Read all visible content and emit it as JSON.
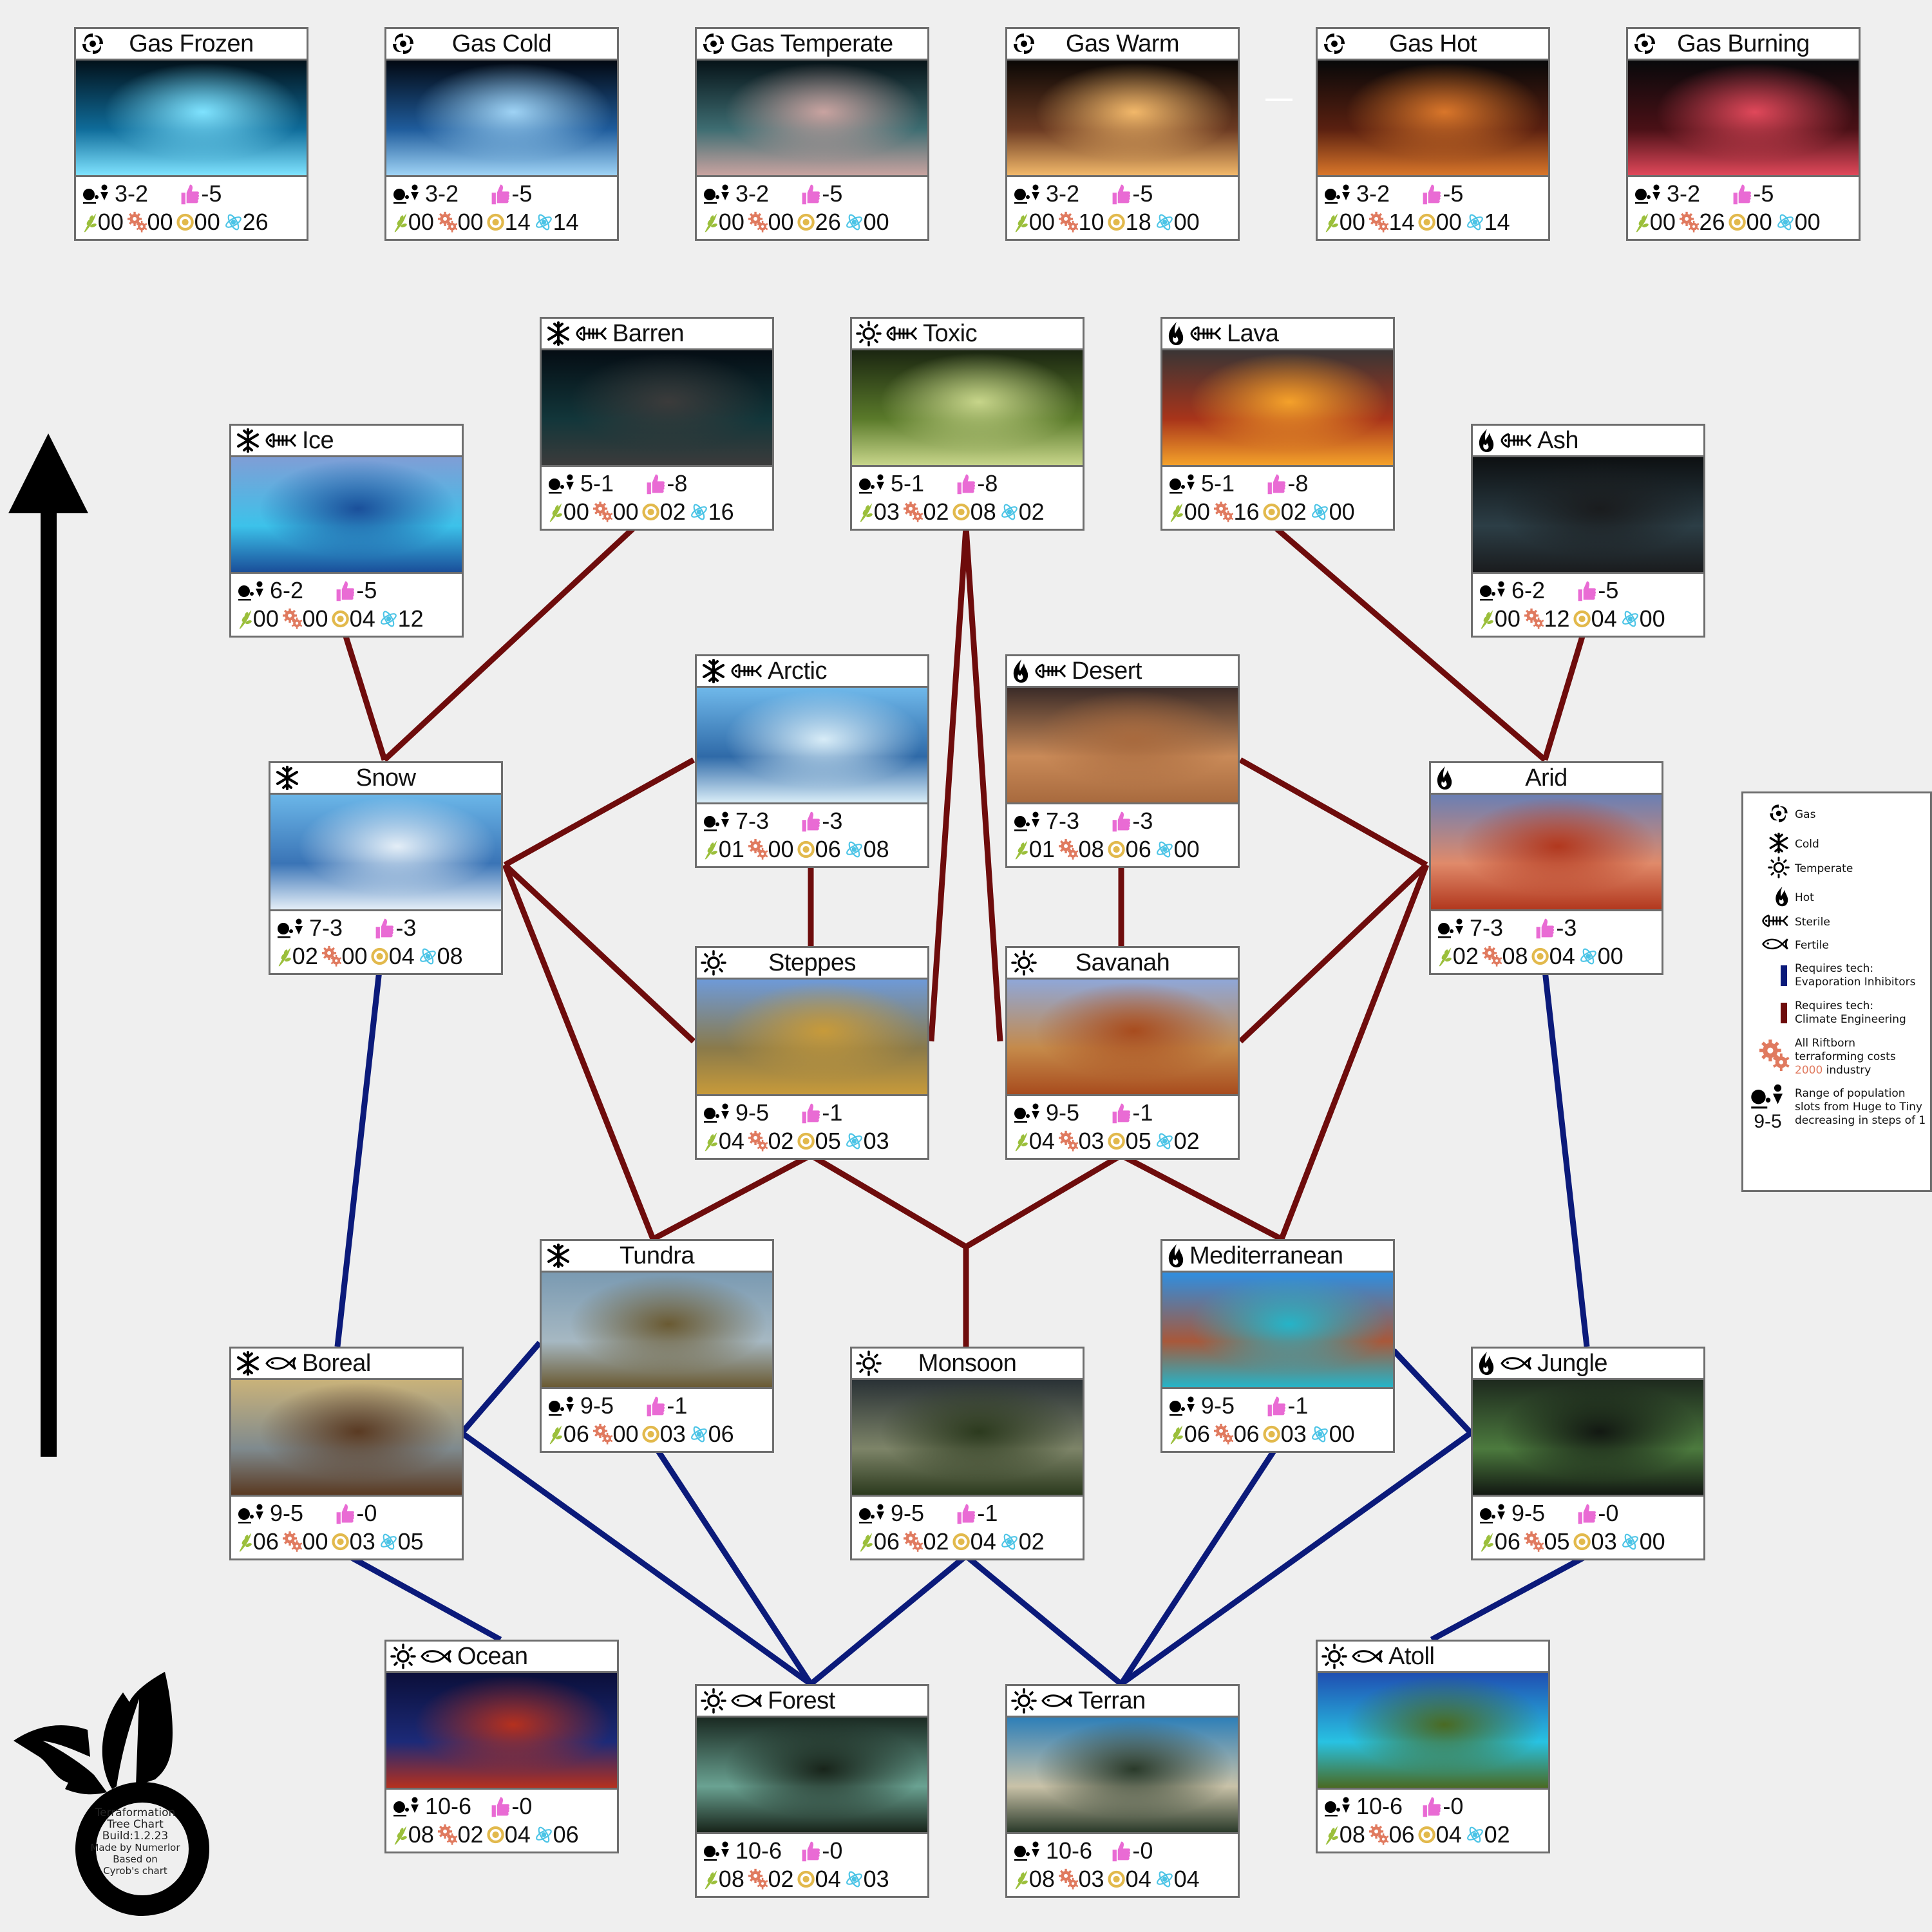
{
  "title": "Terraformation Tree Chart",
  "colors": {
    "background": "#efefef",
    "evaporation_line": "#0b1a7a",
    "climate_line": "#6e0c0c",
    "approval_icon": "#e96bd4",
    "food_icon": "#9bbf3b",
    "industry_icon": "#e07a5f",
    "dust_icon": "#e2b94c",
    "science_icon": "#4cc4e6",
    "industry_highlight": "#e07a5f"
  },
  "cards": [
    {
      "id": "gas-frozen",
      "name": "Gas Frozen",
      "icons": [
        "gas"
      ],
      "centered": true,
      "pop": "3-2",
      "approval": "-5",
      "food": "00",
      "industry": "00",
      "dust": "00",
      "science": "26",
      "img": [
        "#02111a",
        "#0f6c9a",
        "#7fe3ff"
      ]
    },
    {
      "id": "gas-cold",
      "name": "Gas Cold",
      "icons": [
        "gas"
      ],
      "centered": true,
      "pop": "3-2",
      "approval": "-5",
      "food": "00",
      "industry": "00",
      "dust": "14",
      "science": "14",
      "img": [
        "#020812",
        "#1f5c9c",
        "#9fd3f5"
      ]
    },
    {
      "id": "gas-temperate",
      "name": "Gas Temperate",
      "icons": [
        "gas"
      ],
      "centered": false,
      "pop": "3-2",
      "approval": "-5",
      "food": "00",
      "industry": "00",
      "dust": "26",
      "science": "00",
      "img": [
        "#061318",
        "#3e6d72",
        "#c9a3a0"
      ]
    },
    {
      "id": "gas-warm",
      "name": "Gas Warm",
      "icons": [
        "gas"
      ],
      "centered": true,
      "pop": "3-2",
      "approval": "-5",
      "food": "00",
      "industry": "10",
      "dust": "18",
      "science": "00",
      "img": [
        "#0a0705",
        "#6b3a22",
        "#f2b86a"
      ]
    },
    {
      "id": "gas-hot",
      "name": "Gas Hot",
      "icons": [
        "gas"
      ],
      "centered": true,
      "pop": "3-2",
      "approval": "-5",
      "food": "00",
      "industry": "14",
      "dust": "00",
      "science": "14",
      "img": [
        "#070809",
        "#5a2010",
        "#d9762a"
      ]
    },
    {
      "id": "gas-burning",
      "name": "Gas Burning",
      "icons": [
        "gas"
      ],
      "centered": true,
      "pop": "3-2",
      "approval": "-5",
      "food": "00",
      "industry": "26",
      "dust": "00",
      "science": "00",
      "img": [
        "#08090b",
        "#4a1016",
        "#e0485a"
      ]
    },
    {
      "id": "barren",
      "name": "Barren",
      "icons": [
        "cold",
        "sterile"
      ],
      "centered": false,
      "pop": "5-1",
      "approval": "-8",
      "food": "00",
      "industry": "00",
      "dust": "02",
      "science": "16",
      "img": [
        "#050d14",
        "#12363a",
        "#3b3b3b"
      ]
    },
    {
      "id": "toxic",
      "name": "Toxic",
      "icons": [
        "temperate",
        "sterile"
      ],
      "centered": false,
      "pop": "5-1",
      "approval": "-8",
      "food": "03",
      "industry": "02",
      "dust": "08",
      "science": "02",
      "img": [
        "#1b2611",
        "#5a7a2a",
        "#c7d58a"
      ]
    },
    {
      "id": "lava",
      "name": "Lava",
      "icons": [
        "hot",
        "sterile"
      ],
      "centered": false,
      "pop": "5-1",
      "approval": "-8",
      "food": "00",
      "industry": "16",
      "dust": "02",
      "science": "00",
      "img": [
        "#3a3535",
        "#a8341a",
        "#f4a12a"
      ]
    },
    {
      "id": "ice",
      "name": "Ice",
      "icons": [
        "cold",
        "sterile"
      ],
      "centered": false,
      "pop": "6-2",
      "approval": "-5",
      "food": "00",
      "industry": "00",
      "dust": "04",
      "science": "12",
      "img": [
        "#7f9ed6",
        "#3cc2ea",
        "#1a4f9a"
      ]
    },
    {
      "id": "ash",
      "name": "Ash",
      "icons": [
        "hot",
        "sterile"
      ],
      "centered": false,
      "pop": "6-2",
      "approval": "-5",
      "food": "00",
      "industry": "12",
      "dust": "04",
      "science": "00",
      "img": [
        "#0d1012",
        "#2c3e46",
        "#1a1c1e"
      ]
    },
    {
      "id": "arctic",
      "name": "Arctic",
      "icons": [
        "cold",
        "sterile"
      ],
      "centered": false,
      "pop": "7-3",
      "approval": "-3",
      "food": "01",
      "industry": "00",
      "dust": "06",
      "science": "08",
      "img": [
        "#6fb8ea",
        "#2f6aa8",
        "#d8ecf7"
      ]
    },
    {
      "id": "desert",
      "name": "Desert",
      "icons": [
        "hot",
        "sterile"
      ],
      "centered": false,
      "pop": "7-3",
      "approval": "-3",
      "food": "01",
      "industry": "08",
      "dust": "06",
      "science": "00",
      "img": [
        "#3a2b28",
        "#c98a58",
        "#a86a3e"
      ]
    },
    {
      "id": "snow",
      "name": "Snow",
      "icons": [
        "cold"
      ],
      "centered": true,
      "pop": "7-3",
      "approval": "-3",
      "food": "02",
      "industry": "00",
      "dust": "04",
      "science": "08",
      "img": [
        "#6bb6e8",
        "#3a74b6",
        "#e4eef7"
      ]
    },
    {
      "id": "arid",
      "name": "Arid",
      "icons": [
        "hot"
      ],
      "centered": true,
      "pop": "7-3",
      "approval": "-3",
      "food": "02",
      "industry": "08",
      "dust": "04",
      "science": "00",
      "img": [
        "#6a7fb4",
        "#e08a6a",
        "#b2381e"
      ]
    },
    {
      "id": "steppes",
      "name": "Steppes",
      "icons": [
        "temperate"
      ],
      "centered": true,
      "pop": "9-5",
      "approval": "-1",
      "food": "04",
      "industry": "02",
      "dust": "05",
      "science": "03",
      "img": [
        "#6e9ad8",
        "#8a7a4a",
        "#c79a3a"
      ]
    },
    {
      "id": "savanah",
      "name": "Savanah",
      "icons": [
        "temperate"
      ],
      "centered": true,
      "pop": "9-5",
      "approval": "-1",
      "food": "04",
      "industry": "03",
      "dust": "05",
      "science": "02",
      "img": [
        "#8fa7d8",
        "#c58a4a",
        "#a84c1e"
      ]
    },
    {
      "id": "tundra",
      "name": "Tundra",
      "icons": [
        "cold"
      ],
      "centered": true,
      "pop": "9-5",
      "approval": "-1",
      "food": "06",
      "industry": "00",
      "dust": "03",
      "science": "06",
      "img": [
        "#7a9ab2",
        "#a6b8c2",
        "#6a5a32"
      ]
    },
    {
      "id": "mediterranean",
      "name": "Mediterranean",
      "icons": [
        "hot"
      ],
      "centered": false,
      "pop": "9-5",
      "approval": "-1",
      "food": "06",
      "industry": "06",
      "dust": "03",
      "science": "00",
      "img": [
        "#2f8ee0",
        "#a8583a",
        "#25b4c8"
      ]
    },
    {
      "id": "boreal",
      "name": "Boreal",
      "icons": [
        "cold",
        "fertile"
      ],
      "centered": false,
      "pop": "9-5",
      "approval": "-0",
      "food": "06",
      "industry": "00",
      "dust": "03",
      "science": "05",
      "img": [
        "#c9b27a",
        "#7f8a8e",
        "#5a3a22"
      ]
    },
    {
      "id": "monsoon",
      "name": "Monsoon",
      "icons": [
        "temperate"
      ],
      "centered": true,
      "pop": "9-5",
      "approval": "-1",
      "food": "06",
      "industry": "02",
      "dust": "04",
      "science": "02",
      "img": [
        "#2a3236",
        "#7d8468",
        "#2c3a1e"
      ]
    },
    {
      "id": "jungle",
      "name": "Jungle",
      "icons": [
        "hot",
        "fertile"
      ],
      "centered": false,
      "pop": "9-5",
      "approval": "-0",
      "food": "06",
      "industry": "05",
      "dust": "03",
      "science": "00",
      "img": [
        "#1e2a1e",
        "#4c7a3e",
        "#121812"
      ]
    },
    {
      "id": "ocean",
      "name": "Ocean",
      "icons": [
        "temperate",
        "fertile"
      ],
      "centered": false,
      "pop": "10-6",
      "approval": "-0",
      "food": "08",
      "industry": "02",
      "dust": "04",
      "science": "06",
      "img": [
        "#0b0f3a",
        "#1c2a78",
        "#b5301e"
      ]
    },
    {
      "id": "forest",
      "name": "Forest",
      "icons": [
        "temperate",
        "fertile"
      ],
      "centered": false,
      "pop": "10-6",
      "approval": "-0",
      "food": "08",
      "industry": "02",
      "dust": "04",
      "science": "03",
      "img": [
        "#1a2a22",
        "#6aa292",
        "#18241a"
      ]
    },
    {
      "id": "terran",
      "name": "Terran",
      "icons": [
        "temperate",
        "fertile"
      ],
      "centered": false,
      "pop": "10-6",
      "approval": "-0",
      "food": "08",
      "industry": "03",
      "dust": "04",
      "science": "04",
      "img": [
        "#2e7fb8",
        "#c9c2a8",
        "#2a3a2a"
      ]
    },
    {
      "id": "atoll",
      "name": "Atoll",
      "icons": [
        "temperate",
        "fertile"
      ],
      "centered": false,
      "pop": "10-6",
      "approval": "-0",
      "food": "08",
      "industry": "06",
      "dust": "04",
      "science": "02",
      "img": [
        "#1f4fb2",
        "#28c2e2",
        "#4a6a22"
      ]
    }
  ],
  "edges": {
    "climate_engineering": [
      [
        "ice",
        "snow"
      ],
      [
        "barren",
        "snow"
      ],
      [
        "toxic",
        "steppes"
      ],
      [
        "toxic",
        "savanah"
      ],
      [
        "lava",
        "arid"
      ],
      [
        "ash",
        "arid"
      ],
      [
        "arctic",
        "snow"
      ],
      [
        "arctic",
        "steppes"
      ],
      [
        "desert",
        "arid"
      ],
      [
        "desert",
        "savanah"
      ],
      [
        "snow",
        "steppes"
      ],
      [
        "snow",
        "tundra"
      ],
      [
        "arid",
        "savanah"
      ],
      [
        "arid",
        "mediterranean"
      ],
      [
        "steppes",
        "tundra"
      ],
      [
        "steppes",
        "monsoon"
      ],
      [
        "savanah",
        "monsoon"
      ],
      [
        "savanah",
        "mediterranean"
      ]
    ],
    "evaporation_inhibitors": [
      [
        "snow",
        "boreal"
      ],
      [
        "arid",
        "jungle"
      ],
      [
        "tundra",
        "boreal"
      ],
      [
        "boreal",
        "forest"
      ],
      [
        "tundra",
        "forest"
      ],
      [
        "boreal",
        "ocean"
      ],
      [
        "monsoon",
        "forest"
      ],
      [
        "monsoon",
        "terran"
      ],
      [
        "mediterranean",
        "terran"
      ],
      [
        "mediterranean",
        "jungle"
      ],
      [
        "jungle",
        "terran"
      ],
      [
        "jungle",
        "atoll"
      ]
    ]
  },
  "legend": {
    "gas": "Gas",
    "cold": "Cold",
    "temperate": "Temperate",
    "hot": "Hot",
    "sterile": "Sterile",
    "fertile": "Fertile",
    "evap_line1": "Requires tech:",
    "evap_line2": "Evaporation Inhibitors",
    "climate_line1": "Requires tech:",
    "climate_line2": "Climate Engineering",
    "cost_line1": "All Riftborn",
    "cost_line2": "terraforming costs",
    "cost_amount": "2000",
    "cost_unit": " industry",
    "pop_example": "9-5",
    "pop_line1": "Range of population",
    "pop_line2": "slots from Huge to Tiny",
    "pop_line3": "decreasing in steps of 1"
  },
  "logo": {
    "line1": "Terraformation",
    "line2": "Tree Chart",
    "line3": "Build:1.2.23",
    "line4": "Made by Numerlor",
    "line5": "Based on",
    "line6": "Cyrob's chart"
  }
}
